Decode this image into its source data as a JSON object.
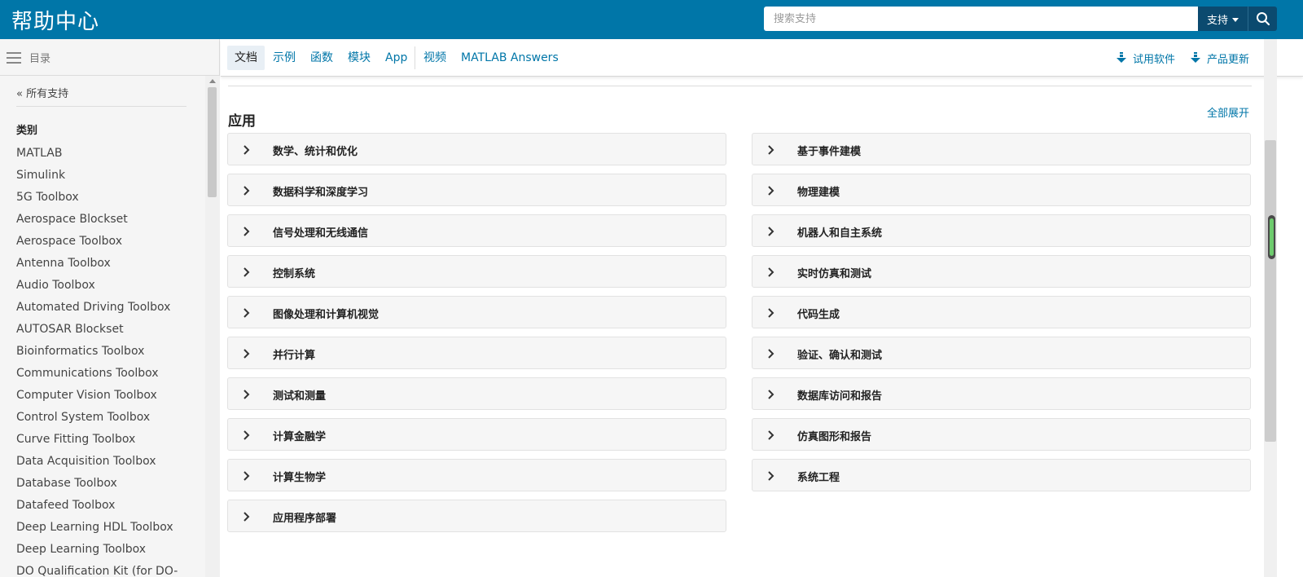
{
  "header": {
    "title": "帮助中心",
    "search_placeholder": "搜索支持",
    "scope_label": "支持",
    "brand_color": "#0076a8"
  },
  "sidebar": {
    "toc_label": "目录",
    "back_link": "« 所有支持",
    "category_heading": "类别",
    "items": [
      "MATLAB",
      "Simulink",
      "5G Toolbox",
      "Aerospace Blockset",
      "Aerospace Toolbox",
      "Antenna Toolbox",
      "Audio Toolbox",
      "Automated Driving Toolbox",
      "AUTOSAR Blockset",
      "Bioinformatics Toolbox",
      "Communications Toolbox",
      "Computer Vision Toolbox",
      "Control System Toolbox",
      "Curve Fitting Toolbox",
      "Data Acquisition Toolbox",
      "Database Toolbox",
      "Datafeed Toolbox",
      "Deep Learning HDL Toolbox",
      "Deep Learning Toolbox",
      "DO Qualification Kit (for DO-"
    ]
  },
  "tabs": {
    "items": [
      "文档",
      "示例",
      "函数",
      "模块",
      "App",
      "视频",
      "MATLAB Answers"
    ],
    "active": "文档",
    "trial_label": "试用软件",
    "updates_label": "产品更新"
  },
  "main": {
    "section_title": "应用",
    "expand_all": "全部展开",
    "left_panels": [
      "数学、统计和优化",
      "数据科学和深度学习",
      "信号处理和无线通信",
      "控制系统",
      "图像处理和计算机视觉",
      "并行计算",
      "测试和测量",
      "计算金融学",
      "计算生物学",
      "应用程序部署"
    ],
    "right_panels": [
      "基于事件建模",
      "物理建模",
      "机器人和自主系统",
      "实时仿真和测试",
      "代码生成",
      "验证、确认和测试",
      "数据库访问和报告",
      "仿真图形和报告",
      "系统工程"
    ]
  }
}
